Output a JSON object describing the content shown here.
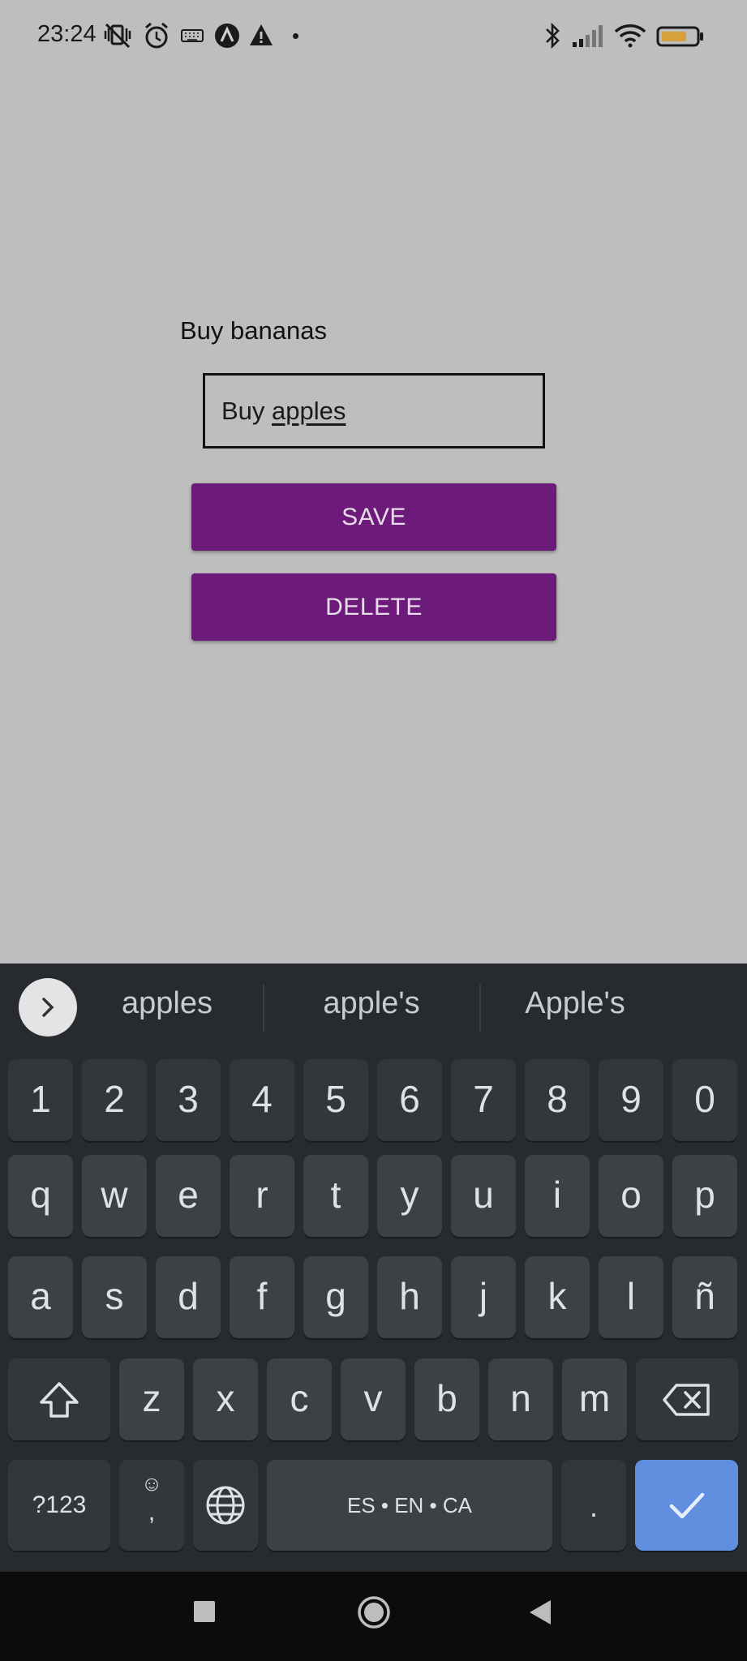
{
  "status_bar": {
    "time": "23:24",
    "left_icons": [
      "mute-vibrate-icon",
      "alarm-icon",
      "keyboard-icon",
      "app-a-icon",
      "warning-icon",
      "dot"
    ],
    "right_icons": [
      "bluetooth-icon",
      "signal-icon",
      "wifi-icon",
      "battery-icon"
    ]
  },
  "app": {
    "task_title": "Buy bananas",
    "input": {
      "prefix": "Buy ",
      "underlined_word": "apples"
    },
    "save_label": "SAVE",
    "delete_label": "DELETE",
    "button_color": "#6c1b7a"
  },
  "keyboard": {
    "suggestions": [
      "apples",
      "apple's",
      "Apple's"
    ],
    "number_row": [
      "1",
      "2",
      "3",
      "4",
      "5",
      "6",
      "7",
      "8",
      "9",
      "0"
    ],
    "row1": [
      "q",
      "w",
      "e",
      "r",
      "t",
      "y",
      "u",
      "i",
      "o",
      "p"
    ],
    "row2": [
      "a",
      "s",
      "d",
      "f",
      "g",
      "h",
      "j",
      "k",
      "l",
      "ñ"
    ],
    "row3": [
      "z",
      "x",
      "c",
      "v",
      "b",
      "n",
      "m"
    ],
    "symbols_label": "?123",
    "emoji_label": "☺",
    "comma_label": ",",
    "space_label": "ES • EN • CA",
    "period_label": ".",
    "enter_color": "#5f8fde"
  },
  "nav_bar": {
    "buttons": [
      "recents-square",
      "home-circle",
      "back-triangle"
    ]
  }
}
